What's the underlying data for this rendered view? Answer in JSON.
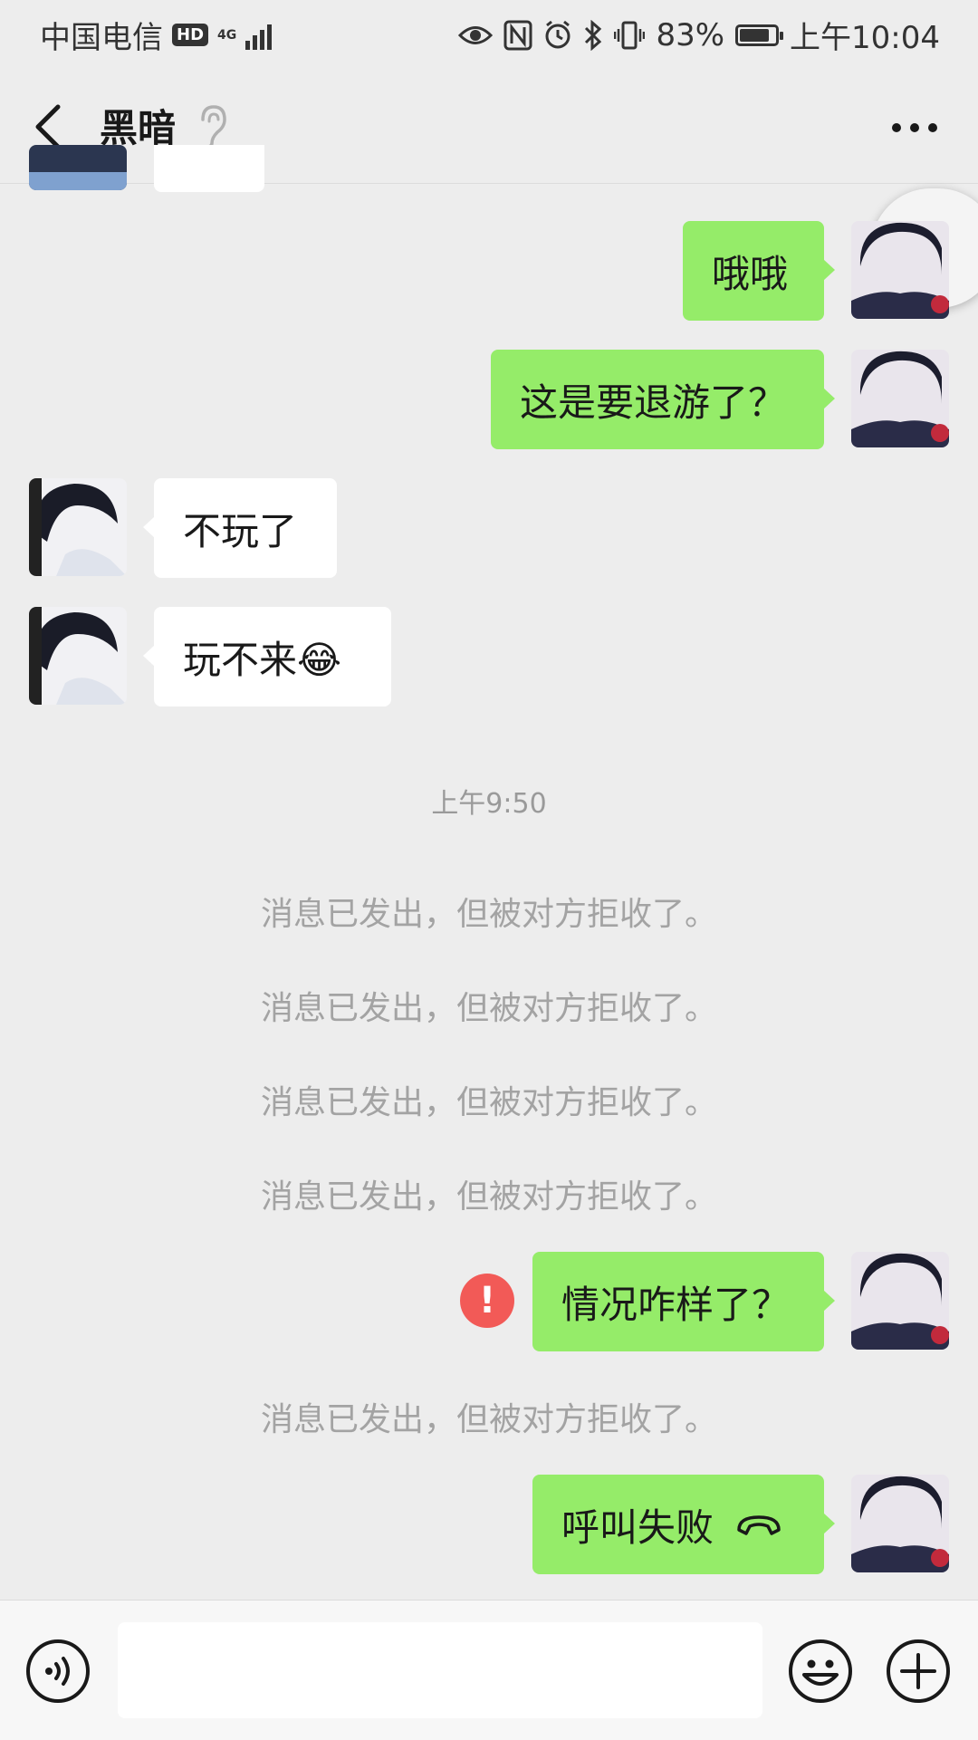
{
  "status_bar": {
    "carrier": "中国电信",
    "hd": "HD",
    "network": "4G",
    "battery": "83%",
    "battery_level": 0.83,
    "time": "上午10:04"
  },
  "header": {
    "title": "黑暗"
  },
  "messages": [
    {
      "from": "me",
      "text": "哦哦"
    },
    {
      "from": "me",
      "text": "这是要退游了？"
    },
    {
      "from": "them",
      "text": "不玩了"
    },
    {
      "from": "them",
      "text": "玩不来😂"
    }
  ],
  "timestamp": "上午9:50",
  "system_notices": [
    "消息已发出，但被对方拒收了。",
    "消息已发出，但被对方拒收了。",
    "消息已发出，但被对方拒收了。",
    "消息已发出，但被对方拒收了。",
    "消息已发出，但被对方拒收了。"
  ],
  "failed_message": {
    "text": "情况咋样了？",
    "error_icon": "!"
  },
  "call_message": {
    "text": "呼叫失败"
  },
  "colors": {
    "my_bubble": "#95ec69",
    "their_bubble": "#ffffff",
    "background": "#ededed",
    "error": "#f25a57"
  },
  "icons": [
    "back-icon",
    "ear-icon",
    "more-icon",
    "voice-icon",
    "emoji-icon",
    "plus-icon",
    "hangup-icon",
    "document-icon"
  ]
}
